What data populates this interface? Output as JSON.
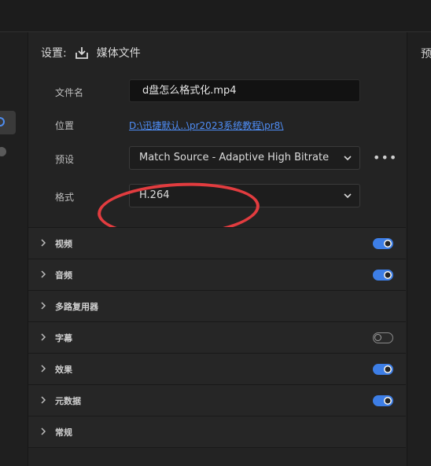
{
  "settings": {
    "heading": "设置:",
    "media_file_label": "媒体文件",
    "filename_label": "文件名",
    "filename_value": "d盘怎么格式化.mp4",
    "location_label": "位置",
    "location_value": "D:\\迅捷默认..\\pr2023系统教程\\pr8\\",
    "preset_label": "预设",
    "preset_value": "Match Source - Adaptive High Bitrate",
    "format_label": "格式",
    "format_value": "H.264"
  },
  "right_panel": {
    "label": "预"
  },
  "sections": [
    {
      "title": "视频",
      "toggle": "on"
    },
    {
      "title": "音频",
      "toggle": "on"
    },
    {
      "title": "多路复用器",
      "toggle": "none"
    },
    {
      "title": "字幕",
      "toggle": "off"
    },
    {
      "title": "效果",
      "toggle": "on"
    },
    {
      "title": "元数据",
      "toggle": "on"
    },
    {
      "title": "常规",
      "toggle": "none"
    }
  ],
  "colors": {
    "accent": "#3d7ee6",
    "link": "#4f8ef7",
    "annotation": "#e23c3f"
  },
  "icons": {
    "export": "export-icon",
    "dropdown": "chevron-down-icon",
    "expand": "chevron-right-icon",
    "more": "more-icon"
  }
}
